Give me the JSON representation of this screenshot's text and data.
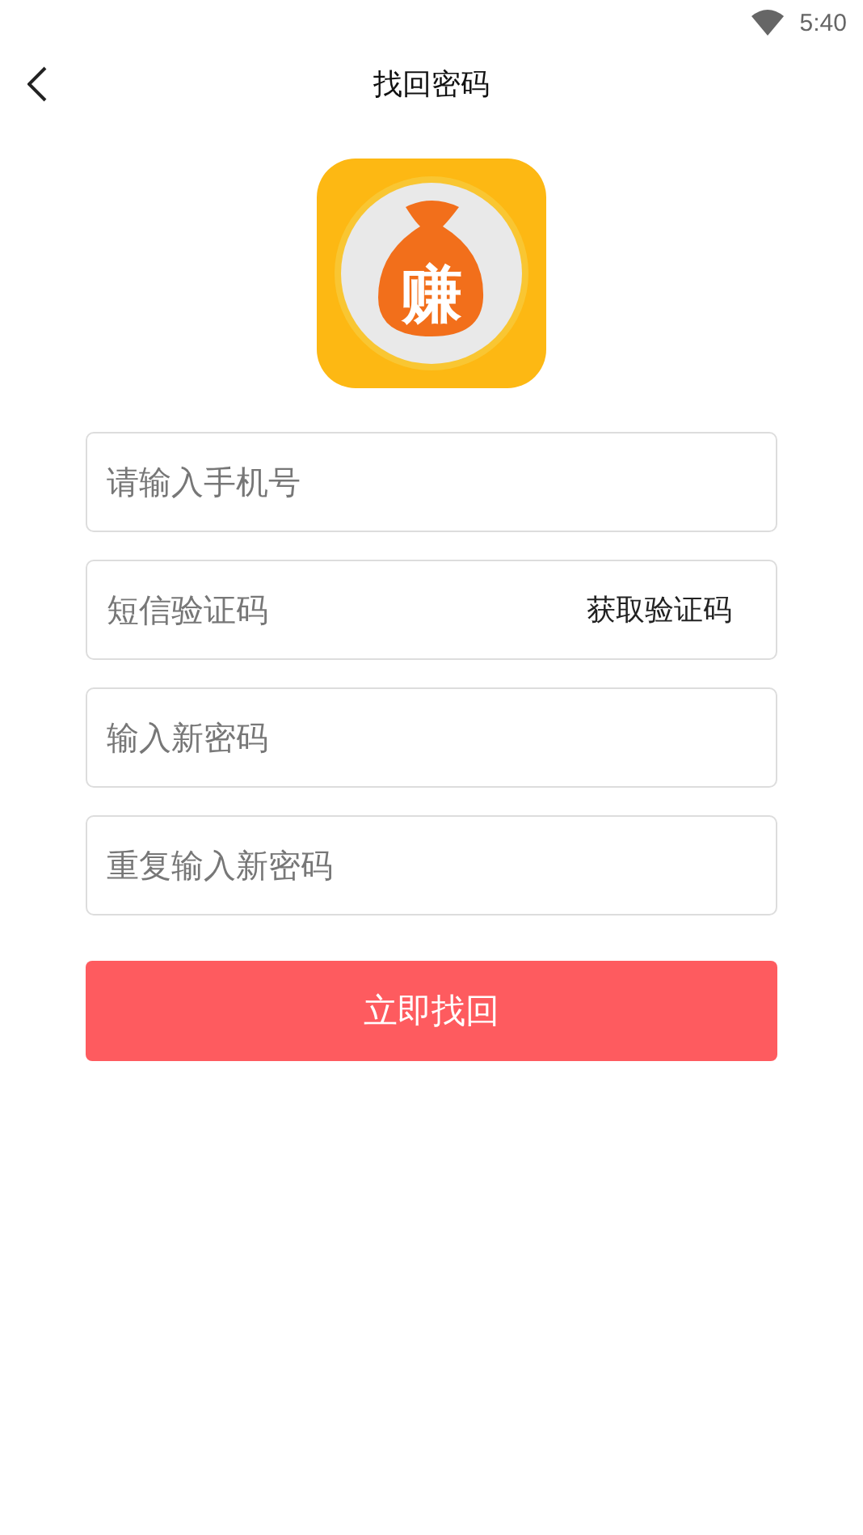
{
  "status_bar": {
    "time": "5:40"
  },
  "header": {
    "title": "找回密码"
  },
  "logo": {
    "text": "赚"
  },
  "fields": [
    {
      "kind": "text",
      "placeholder": "请输入手机号"
    },
    {
      "kind": "code",
      "placeholder": "短信验证码",
      "action": "获取验证码"
    },
    {
      "kind": "text",
      "placeholder": "输入新密码"
    },
    {
      "kind": "text",
      "placeholder": "重复输入新密码"
    }
  ],
  "submit": "立即找回"
}
